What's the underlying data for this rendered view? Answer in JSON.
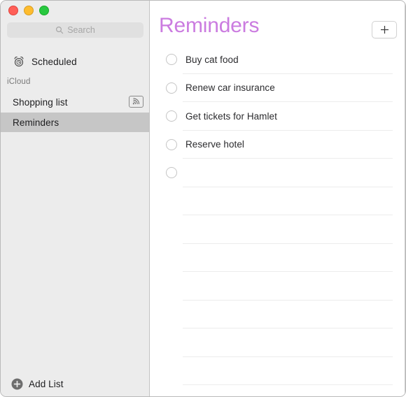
{
  "window": {
    "traffic_lights": {
      "close_color": "#ff5f57",
      "minimize_color": "#febc2e",
      "maximize_color": "#28c840",
      "close_label": "Close",
      "minimize_label": "Minimize",
      "maximize_label": "Zoom"
    }
  },
  "sidebar": {
    "search": {
      "placeholder": "Search",
      "value": "",
      "icon": "search-icon"
    },
    "smart_lists": [
      {
        "label": "Scheduled",
        "icon": "alarm-clock-icon",
        "selected": false
      }
    ],
    "group_header": "iCloud",
    "lists": [
      {
        "label": "Shopping list",
        "selected": false,
        "shared": true,
        "shared_icon": "broadcast-icon"
      },
      {
        "label": "Reminders",
        "selected": true,
        "shared": false
      }
    ],
    "add_list": {
      "label": "Add List",
      "icon": "plus-circle-icon"
    }
  },
  "main": {
    "title": "Reminders",
    "title_color": "#cb7ce0",
    "add_button": {
      "label": "+",
      "icon": "plus-icon",
      "tooltip": "New Reminder"
    },
    "reminders": [
      {
        "text": "Buy cat food",
        "completed": false
      },
      {
        "text": "Renew car insurance",
        "completed": false
      },
      {
        "text": "Get tickets for Hamlet",
        "completed": false
      },
      {
        "text": "Reserve hotel",
        "completed": false
      },
      {
        "text": "",
        "completed": false
      }
    ],
    "empty_rows": 7
  }
}
